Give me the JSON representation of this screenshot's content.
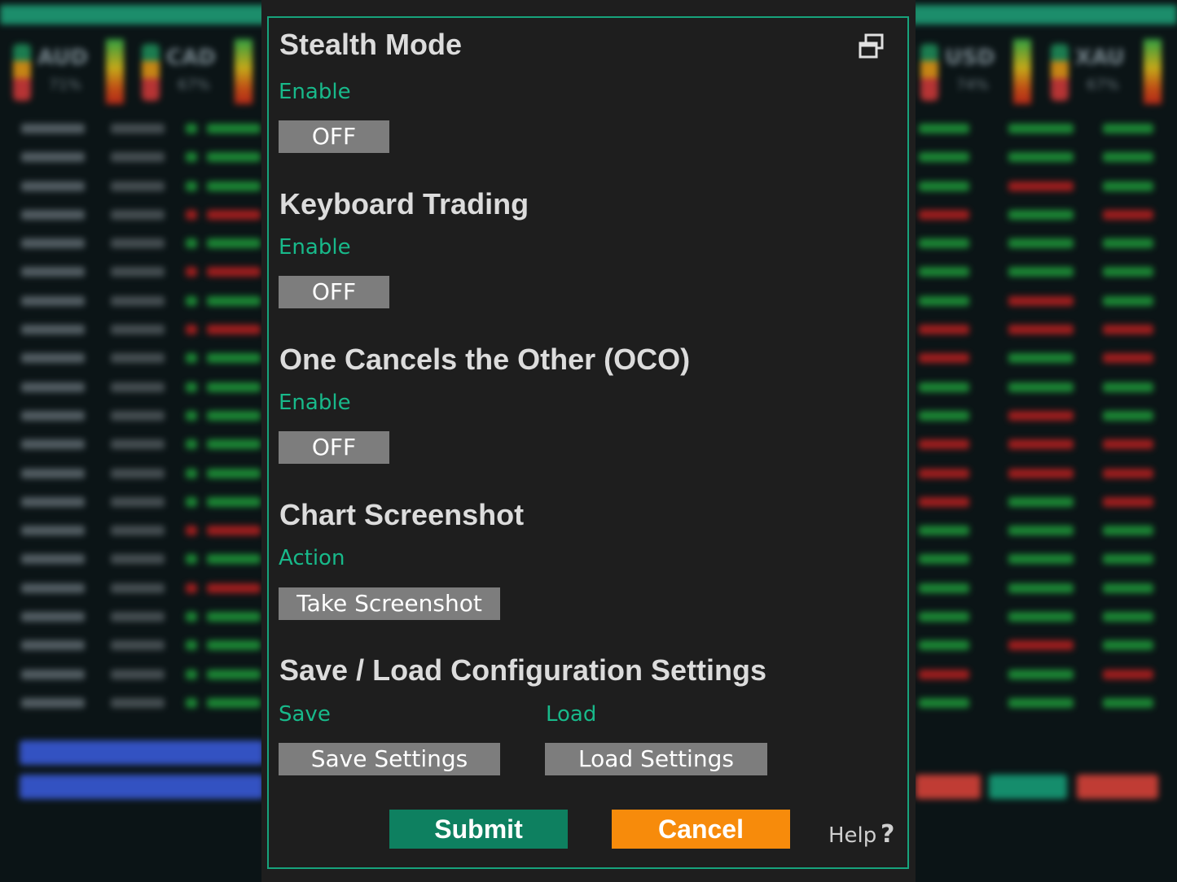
{
  "dialog": {
    "stealth": {
      "title": "Stealth Mode",
      "label": "Enable",
      "value": "OFF"
    },
    "keyboard": {
      "title": "Keyboard Trading",
      "label": "Enable",
      "value": "OFF"
    },
    "oco": {
      "title": "One Cancels the Other (OCO)",
      "label": "Enable",
      "value": "OFF"
    },
    "screenshot": {
      "title": "Chart Screenshot",
      "label": "Action",
      "button": "Take Screenshot"
    },
    "config": {
      "title": "Save / Load Configuration Settings",
      "save_label": "Save",
      "save_button": "Save Settings",
      "load_label": "Load",
      "load_button": "Load Settings"
    },
    "submit": "Submit",
    "cancel": "Cancel",
    "help": "Help",
    "help_mark": "?",
    "icons": {
      "window": "restore-window-icon"
    }
  },
  "background": {
    "currencies": [
      "AUD",
      "CAD",
      "USD",
      "XAU"
    ],
    "percents": [
      "71%",
      "67%",
      "74%",
      "67%"
    ]
  },
  "colors": {
    "accent": "#17a37c",
    "label": "#18b98a",
    "toggle_bg": "#7d7d7d",
    "submit_bg": "#0e8060",
    "cancel_bg": "#f78b0b",
    "dialog_bg": "#1e1e1e"
  }
}
